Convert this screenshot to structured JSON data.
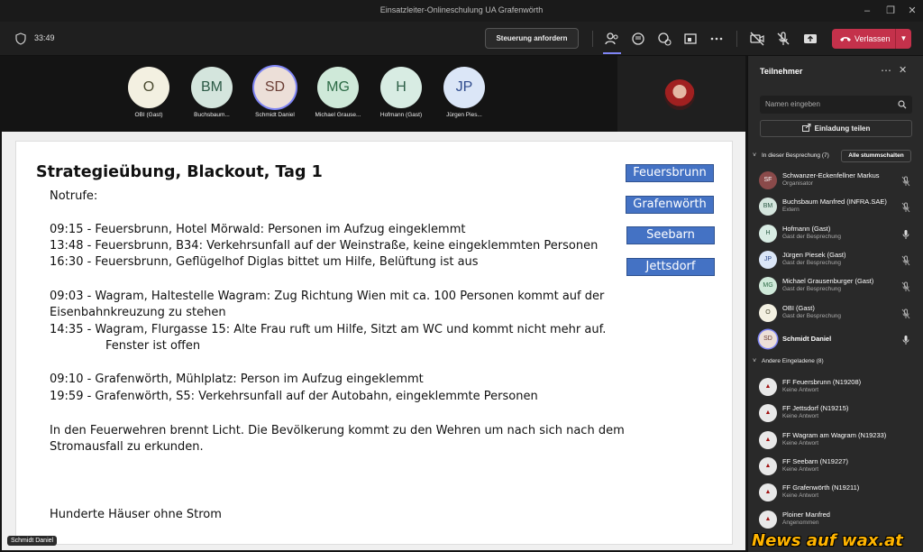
{
  "window": {
    "title": "Einsatzleiter-Onlineschulung UA Grafenwörth"
  },
  "toolbar": {
    "timer": "33:49",
    "control_request_label": "Steuerung anfordern",
    "leave_label": "Verlassen",
    "icons": [
      "participants-icon",
      "chat-icon",
      "reactions-icon",
      "rooms-icon",
      "more-icon",
      "camera-off-icon",
      "mic-off-icon",
      "share-icon"
    ]
  },
  "stage": {
    "participants": [
      {
        "initials": "O",
        "name": "OBI (Gast)",
        "bg": "#f3f0e1",
        "fg": "#4a4a30",
        "muted": true
      },
      {
        "initials": "BM",
        "name": "Buchsbaum...",
        "bg": "#d4e5dd",
        "fg": "#2c5a46",
        "muted": true
      },
      {
        "initials": "SD",
        "name": "Schmidt Daniel",
        "bg": "#ecdfd8",
        "fg": "#6b3e35",
        "muted": false,
        "speaking": true
      },
      {
        "initials": "MG",
        "name": "Michael Grause...",
        "bg": "#cfe9d9",
        "fg": "#2d6b46",
        "muted": false
      },
      {
        "initials": "H",
        "name": "Hofmann (Gast)",
        "bg": "#d8ece3",
        "fg": "#2e5f48",
        "muted": false
      },
      {
        "initials": "JP",
        "name": "Jürgen Pies...",
        "bg": "#dbe6f7",
        "fg": "#2e4a8c",
        "muted": true
      }
    ],
    "presenter_tag": "Schmidt Daniel"
  },
  "slide": {
    "title": "Strategieübung, Blackout, Tag 1",
    "lines": [
      "Notrufe:",
      "09:15 - Feuersbrunn, Hotel Mörwald: Personen im Aufzug eingeklemmt",
      "13:48 - Feuersbrunn, B34: Verkehrsunfall auf der Weinstraße, keine eingeklemmten Personen",
      "16:30 - Feuersbrunn, Geflügelhof Diglas bittet um Hilfe, Belüftung ist aus",
      "09:03 - Wagram, Haltestelle Wagram: Zug Richtung Wien mit ca. 100 Personen kommt auf der",
      "Eisenbahnkreuzung zu stehen",
      "14:35 - Wagram, Flurgasse 15: Alte Frau ruft um Hilfe, Sitzt am WC und kommt nicht mehr auf.",
      "Fenster ist offen",
      "09:10 - Grafenwörth, Mühlplatz: Person im Aufzug eingeklemmt",
      "19:59 - Grafenwörth, S5: Verkehrsunfall auf der Autobahn, eingeklemmte Personen",
      "In den Feuerwehren brennt Licht. Die Bevölkerung kommt zu den Wehren um nach sich nach dem",
      "Stromausfall zu erkunden.",
      "Hunderte Häuser ohne Strom"
    ],
    "locations": [
      "Feuersbrunn",
      "Grafenwörth",
      "Seebarn",
      "Jettsdorf"
    ]
  },
  "panel": {
    "title": "Teilnehmer",
    "search_placeholder": "Namen eingeben",
    "invite_label": "Einladung teilen",
    "in_meeting_label": "In dieser Besprechung (7)",
    "mute_all_label": "Alle stummschalten",
    "in_meeting": [
      {
        "initials": "SF",
        "name": "Schwanzer-Eckenfellner Markus",
        "sub": "Organisator",
        "bg": "#8a4a4a",
        "fg": "#fff",
        "mic": "off"
      },
      {
        "initials": "BM",
        "name": "Buchsbaum Manfred (INFRA.SAE)",
        "sub": "Extern",
        "bg": "#d4e5dd",
        "fg": "#2c5a46",
        "mic": "off"
      },
      {
        "initials": "H",
        "name": "Hofmann (Gast)",
        "sub": "Gast der Besprechung",
        "bg": "#d8ece3",
        "fg": "#2e5f48",
        "mic": "on"
      },
      {
        "initials": "JP",
        "name": "Jürgen Piesek (Gast)",
        "sub": "Gast der Besprechung",
        "bg": "#dbe6f7",
        "fg": "#2e4a8c",
        "mic": "off"
      },
      {
        "initials": "MG",
        "name": "Michael Grausenburger (Gast)",
        "sub": "Gast der Besprechung",
        "bg": "#cfe9d9",
        "fg": "#2d6b46",
        "mic": "off"
      },
      {
        "initials": "O",
        "name": "OBI (Gast)",
        "sub": "Gast der Besprechung",
        "bg": "#f3f0e1",
        "fg": "#4a4a30",
        "mic": "off"
      },
      {
        "initials": "SD",
        "name": "Schmidt Daniel",
        "sub": "",
        "bg": "#ecdfd8",
        "fg": "#6b3e35",
        "mic": "on"
      }
    ],
    "others_label": "Andere Eingeladene (8)",
    "others": [
      {
        "name": "FF Feuersbrunn (N19208)",
        "sub": "Keine Antwort"
      },
      {
        "name": "FF Jettsdorf (N19215)",
        "sub": "Keine Antwort"
      },
      {
        "name": "FF Wagram am Wagram (N19233)",
        "sub": "Keine Antwort"
      },
      {
        "name": "FF Seebarn (N19227)",
        "sub": "Keine Antwort"
      },
      {
        "name": "FF Grafenwörth (N19211)",
        "sub": "Keine Antwort"
      },
      {
        "name": "Ploiner Manfred",
        "sub": "Angenommen"
      }
    ]
  },
  "watermark": "News auf wax.at"
}
